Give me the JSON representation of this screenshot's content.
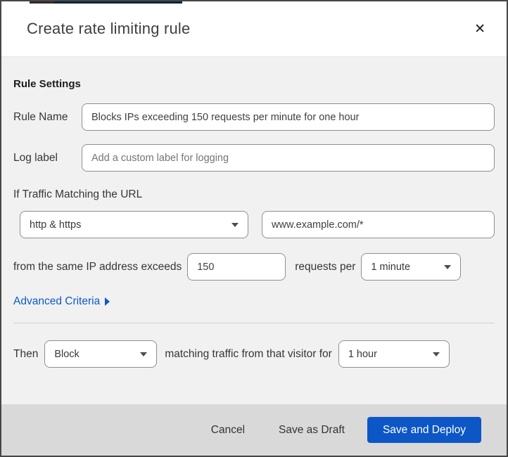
{
  "colors": {
    "primary_blue": "#0d56c5",
    "link_blue": "#0b5cc4",
    "body_bg": "#f1f1f2",
    "footer_bg": "#d9d9d9"
  },
  "header": {
    "title": "Create rate limiting rule",
    "close_icon": "✕"
  },
  "rule_settings": {
    "heading": "Rule Settings",
    "rule_name_label": "Rule Name",
    "rule_name_value": "Blocks IPs exceeding 150 requests per minute for one hour",
    "log_label_label": "Log label",
    "log_label_placeholder": "Add a custom label for logging"
  },
  "match": {
    "heading": "If Traffic Matching the URL",
    "protocol_selected": "http & https",
    "url_value": "www.example.com/*",
    "threshold_prefix": "from the same IP address exceeds",
    "threshold_value": "150",
    "threshold_unit_text": "requests per",
    "period_selected": "1 minute",
    "advanced_link": "Advanced Criteria"
  },
  "action": {
    "then_label": "Then",
    "action_selected": "Block",
    "middle_text": "matching traffic from that visitor for",
    "duration_selected": "1 hour"
  },
  "footer": {
    "cancel": "Cancel",
    "save_draft": "Save as Draft",
    "save_deploy": "Save and Deploy"
  }
}
